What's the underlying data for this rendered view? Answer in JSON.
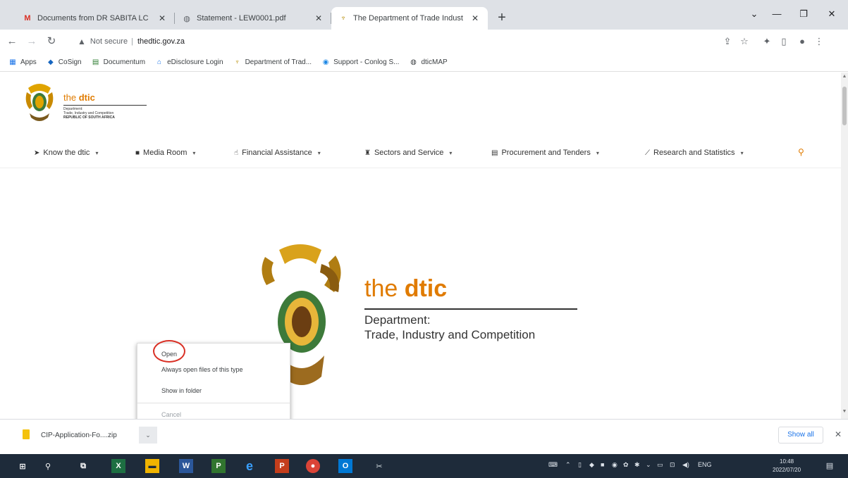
{
  "browser": {
    "tabs": [
      {
        "favicon": "gmail-icon",
        "title": "Documents from DR SABITA LC",
        "active": false
      },
      {
        "favicon": "globe-icon",
        "title": "Statement - LEW0001.pdf",
        "active": false
      },
      {
        "favicon": "dtic-coat-of-arms-icon",
        "title": "The Department of Trade Indust",
        "active": true
      }
    ],
    "new_tab": "+",
    "window_controls": {
      "minimize": "—",
      "restore": "❐",
      "close": "✕",
      "tab_search": "⌄"
    },
    "address": {
      "security_label": "Not secure",
      "separator": "|",
      "url": "thedtic.gov.za"
    },
    "bookmarks": [
      {
        "icon": "apps-grid-icon",
        "label": "Apps"
      },
      {
        "icon": "cosign-icon",
        "label": "CoSign"
      },
      {
        "icon": "documentum-icon",
        "label": "Documentum"
      },
      {
        "icon": "edisclosure-icon",
        "label": "eDisclosure Login"
      },
      {
        "icon": "dtic-coat-of-arms-icon",
        "label": "Department of Trad..."
      },
      {
        "icon": "support-icon",
        "label": "Support - Conlog S..."
      },
      {
        "icon": "globe-icon",
        "label": "dticMAP"
      }
    ]
  },
  "site": {
    "logo": {
      "brand_prefix": "the ",
      "brand_bold": "dtic",
      "dept_line1": "Department:",
      "dept_line2": "Trade, Industry and Competition",
      "country": "REPUBLIC OF SOUTH AFRICA"
    },
    "nav": [
      {
        "icon": "hand-pointer-icon",
        "label": "Know the dtic"
      },
      {
        "icon": "video-camera-icon",
        "label": "Media Room"
      },
      {
        "icon": "thumbs-up-icon",
        "label": "Financial Assistance"
      },
      {
        "icon": "industry-icon",
        "label": "Sectors and Service"
      },
      {
        "icon": "document-list-icon",
        "label": "Procurement and Tenders"
      },
      {
        "icon": "chart-line-icon",
        "label": "Research and Statistics"
      }
    ],
    "hero": {
      "brand_prefix": "the ",
      "brand_bold": "dtic",
      "line1": "Department:",
      "line2": "Trade, Industry and Competition"
    }
  },
  "context_menu": {
    "items": [
      {
        "label": "Open",
        "enabled": true
      },
      {
        "label": "Always open files of this type",
        "enabled": true
      },
      {
        "label": "Show in folder",
        "enabled": true
      },
      {
        "label": "Cancel",
        "enabled": false
      }
    ]
  },
  "download_shelf": {
    "file_name": "CIP-Application-Fo....zip",
    "menu_arrow": "⌄",
    "show_all": "Show all",
    "close": "✕"
  },
  "taskbar": {
    "apps": [
      "windows-start-icon",
      "search-icon",
      "task-view-icon",
      "excel-icon",
      "file-explorer-icon",
      "word-icon",
      "project-icon",
      "internet-explorer-icon",
      "powerpoint-icon",
      "chrome-icon",
      "outlook-icon",
      "snipping-tool-icon"
    ],
    "language": "ENG",
    "time": "10:48",
    "date": "2022/07/20"
  },
  "colors": {
    "accent": "#e07b00",
    "taskbar": "#1e2b3a",
    "highlight_ring": "#d93025",
    "link": "#1a73e8"
  }
}
